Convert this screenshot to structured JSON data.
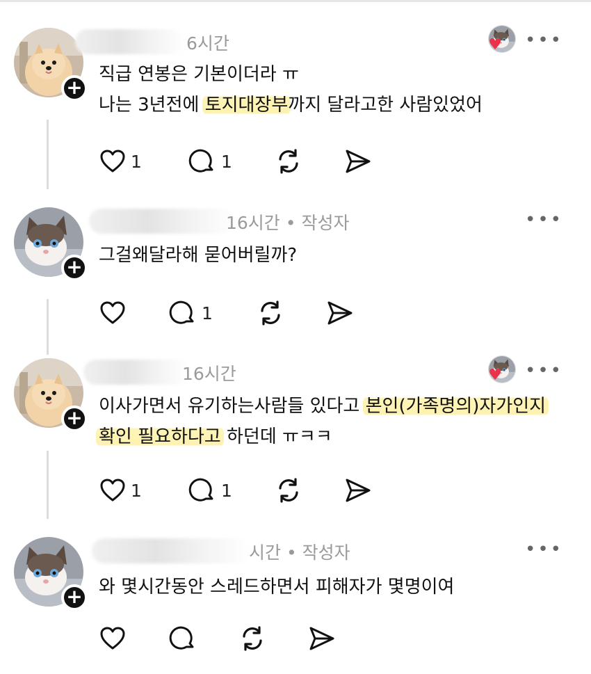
{
  "posts": [
    {
      "time": "6시간",
      "author_tag": "",
      "lines": [
        [
          {
            "t": "직급 연봉은 기본이더라 ㅠ",
            "h": false
          }
        ],
        [
          {
            "t": "나는 3년전에 ",
            "h": false
          },
          {
            "t": "토지대장부",
            "h": true
          },
          {
            "t": "까지 달라고한 사람있었어",
            "h": false
          }
        ]
      ],
      "likes": "1",
      "replies": "1",
      "liked_by_author": true
    },
    {
      "time": "16시간",
      "author_tag": "• 작성자",
      "lines": [
        [
          {
            "t": "그걸왜달라해 묻어버릴까?",
            "h": false
          }
        ]
      ],
      "likes": "",
      "replies": "1",
      "liked_by_author": false
    },
    {
      "time": "16시간",
      "author_tag": "",
      "lines": [
        [
          {
            "t": "이사가면서 유기하는사람들 있다고 ",
            "h": false
          },
          {
            "t": "본인(가족명의)자가인지",
            "h": true
          }
        ],
        [
          {
            "t": "확인 필요하다고",
            "h": true
          },
          {
            "t": " 하던데 ㅠㅋㅋ",
            "h": false
          }
        ]
      ],
      "likes": "1",
      "replies": "1",
      "liked_by_author": true
    },
    {
      "time": "시간",
      "author_tag": "• 작성자",
      "lines": [
        [
          {
            "t": "와 몇시간동안 스레드하면서 피해자가 몇명이여",
            "h": false
          }
        ]
      ],
      "likes": "",
      "replies": "",
      "liked_by_author": false
    }
  ],
  "icons": {
    "like": "heart-outline-icon",
    "reply": "speech-bubble-icon",
    "repost": "repost-arrows-icon",
    "share": "paper-plane-icon",
    "more": "more-dots-icon",
    "follow": "plus-icon"
  },
  "colors": {
    "highlight": "#fdf2b0",
    "heart": "#e8334a",
    "meta_text": "#9a9a9a"
  }
}
